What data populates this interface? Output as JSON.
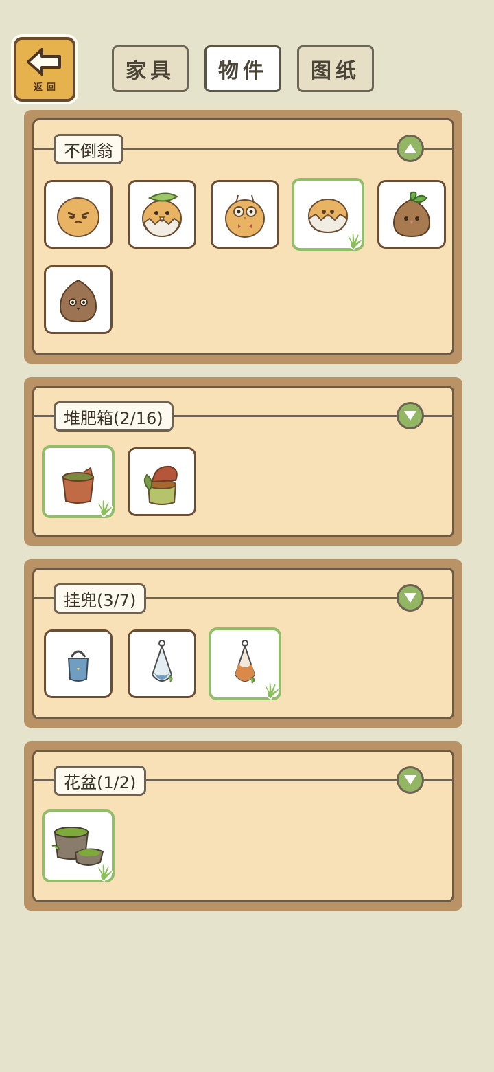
{
  "back_button": {
    "label": "返回",
    "icon": "back-arrow-icon"
  },
  "tabs": [
    {
      "label": "家具",
      "active": false
    },
    {
      "label": "物件",
      "active": true
    },
    {
      "label": "图纸",
      "active": false
    }
  ],
  "sections": [
    {
      "title": "不倒翁",
      "expanded": true,
      "items": [
        {
          "name": "tumbler-round-face",
          "selected": false
        },
        {
          "name": "tumbler-leaf-eggshell",
          "selected": false
        },
        {
          "name": "tumbler-owl",
          "selected": false
        },
        {
          "name": "tumbler-eggshell",
          "selected": true
        },
        {
          "name": "tumbler-sprout-seed",
          "selected": false
        },
        {
          "name": "tumbler-brown-seed",
          "selected": false
        }
      ]
    },
    {
      "title": "堆肥箱(2/16)",
      "expanded": false,
      "items": [
        {
          "name": "compost-stump-bin",
          "selected": true
        },
        {
          "name": "compost-leaf-bin",
          "selected": false
        }
      ]
    },
    {
      "title": "挂兜(3/7)",
      "expanded": false,
      "items": [
        {
          "name": "hanging-bucket",
          "selected": false
        },
        {
          "name": "hanging-net-blue",
          "selected": false
        },
        {
          "name": "hanging-net-orange",
          "selected": true
        }
      ]
    },
    {
      "title": "花盆(1/2)",
      "expanded": false,
      "items": [
        {
          "name": "moss-stump-pot",
          "selected": true
        }
      ]
    }
  ],
  "colors": {
    "background": "#e6e3cc",
    "panel_frame": "#b99365",
    "panel_fill": "#f8e1b6",
    "accent_green": "#92b664",
    "back_button": "#e5b24e"
  }
}
